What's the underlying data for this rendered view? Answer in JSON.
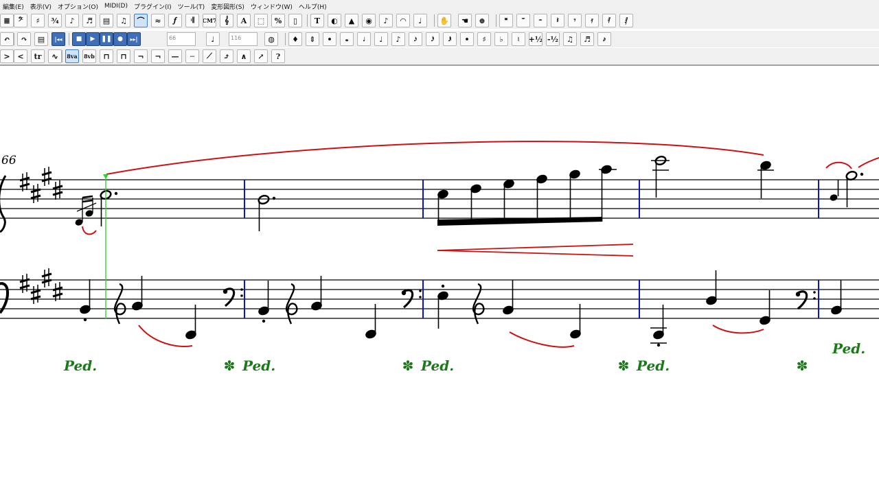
{
  "menu": [
    "編集(E)",
    "表示(V)",
    "オプション(O)",
    "MIDI(D)",
    "プラグイン(I)",
    "ツール(T)",
    "変形図形(S)",
    "ウィンドウ(W)",
    "ヘルプ(H)"
  ],
  "toolbar1": [
    {
      "name": "staff-tool-button",
      "glyph": "≣"
    },
    {
      "name": "clef-tool-button",
      "glyph": "𝄢"
    },
    {
      "name": "key-signature-tool-button",
      "glyph": "♯"
    },
    {
      "name": "time-signature-tool-button",
      "glyph": "¾"
    },
    {
      "name": "note-tool-button",
      "glyph": "♪"
    },
    {
      "name": "simple-entry-button",
      "glyph": "♬"
    },
    {
      "name": "measure-tool-button",
      "glyph": "▤"
    },
    {
      "name": "tuplet-tool-button",
      "glyph": "♫"
    },
    {
      "name": "smart-shape-tool-button",
      "glyph": "⌒"
    },
    {
      "name": "articulation-tool-button",
      "glyph": "≈"
    },
    {
      "name": "expression-tool-button",
      "glyph": "𝆑"
    },
    {
      "name": "repeat-tool-button",
      "glyph": "𝄇"
    },
    {
      "name": "chord-tool-button",
      "glyph": "CM7"
    },
    {
      "name": "lyrics-tool-button",
      "glyph": "𝄞"
    },
    {
      "name": "text-tool-button",
      "glyph": "A"
    },
    {
      "name": "selection-tool-button",
      "glyph": "⬚"
    },
    {
      "name": "resize-tool-button",
      "glyph": "%"
    },
    {
      "name": "page-layout-tool-button",
      "glyph": "▯"
    },
    {
      "name": "special-tools-button",
      "glyph": "T"
    },
    {
      "name": "mirror-tool-button",
      "glyph": "◐"
    },
    {
      "name": "graphics-tool-button",
      "glyph": "▲"
    },
    {
      "name": "speedy-entry-button",
      "glyph": "◉"
    },
    {
      "name": "playback-controls-button",
      "glyph": "♪"
    },
    {
      "name": "ossia-tool-button",
      "glyph": "◠"
    },
    {
      "name": "tempo-tool-button",
      "glyph": "♩"
    },
    {
      "name": "hand-grabber-button",
      "glyph": "✋"
    },
    {
      "name": "scroll-view-button",
      "glyph": "☚"
    },
    {
      "name": "zoom-tool-button",
      "glyph": "⊕"
    },
    {
      "name": "double-whole-rest-button",
      "glyph": "𝄺"
    },
    {
      "name": "whole-rest-button",
      "glyph": "𝄻"
    },
    {
      "name": "half-rest-button",
      "glyph": "𝄼"
    },
    {
      "name": "quarter-rest-button",
      "glyph": "𝄽"
    },
    {
      "name": "eighth-rest-button",
      "glyph": "𝄾"
    },
    {
      "name": "sixteenth-rest-button",
      "glyph": "𝄿"
    },
    {
      "name": "thirty-second-rest-button",
      "glyph": "𝅀"
    },
    {
      "name": "sixty-fourth-rest-button",
      "glyph": "𝅁"
    }
  ],
  "toolbar2": [
    {
      "name": "undo-button",
      "glyph": "↶"
    },
    {
      "name": "redo-button",
      "glyph": "↷"
    },
    {
      "name": "page-button",
      "glyph": "▤"
    },
    {
      "name": "rewind-button",
      "glyph": "|◂◂"
    },
    {
      "name": "stop-button",
      "glyph": "■"
    },
    {
      "name": "play-button",
      "glyph": "▶"
    },
    {
      "name": "pause-button",
      "glyph": "❚❚"
    },
    {
      "name": "record-button",
      "glyph": "●"
    },
    {
      "name": "fast-forward-button",
      "glyph": "▸▸|"
    },
    {
      "name": "tempo-note-button",
      "glyph": "♩"
    },
    {
      "name": "midi-device-button",
      "glyph": "◍"
    },
    {
      "name": "hyper-scribe-button",
      "glyph": "♦"
    },
    {
      "name": "voice-button",
      "glyph": "⇕"
    },
    {
      "name": "dot-tool-button",
      "glyph": "•"
    },
    {
      "name": "whole-note-button",
      "glyph": "𝅝"
    },
    {
      "name": "half-note-button",
      "glyph": "𝅗𝅥"
    },
    {
      "name": "quarter-note-button",
      "glyph": "♩"
    },
    {
      "name": "eighth-note-button",
      "glyph": "♪"
    },
    {
      "name": "sixteenth-note-button",
      "glyph": "𝅘𝅥𝅯"
    },
    {
      "name": "thirty-second-note-button",
      "glyph": "𝅘𝅥𝅰"
    },
    {
      "name": "sixty-fourth-note-button",
      "glyph": "𝅘𝅥𝅱"
    },
    {
      "name": "augmentation-dot-button",
      "glyph": "•"
    },
    {
      "name": "sharp-button",
      "glyph": "♯"
    },
    {
      "name": "flat-button",
      "glyph": "♭"
    },
    {
      "name": "natural-button",
      "glyph": "♮"
    },
    {
      "name": "half-step-up-button",
      "glyph": "+½"
    },
    {
      "name": "half-step-down-button",
      "glyph": "-½"
    },
    {
      "name": "tie-button",
      "glyph": "♫"
    },
    {
      "name": "tuplet-button",
      "glyph": "♬"
    },
    {
      "name": "grace-note-button",
      "glyph": "𝆔"
    }
  ],
  "toolbar3": [
    {
      "name": "crescendo-button",
      "glyph": ">"
    },
    {
      "name": "decrescendo-button",
      "glyph": "<"
    },
    {
      "name": "trill-button",
      "glyph": "tr"
    },
    {
      "name": "trill-extension-button",
      "glyph": "∿"
    },
    {
      "name": "octave-up-button",
      "glyph": "8va"
    },
    {
      "name": "octave-down-button",
      "glyph": "8vb"
    },
    {
      "name": "bracket-button",
      "glyph": "⊓"
    },
    {
      "name": "dashed-bracket-button",
      "glyph": "⊓"
    },
    {
      "name": "end-bracket-button",
      "glyph": "¬"
    },
    {
      "name": "dashed-end-bracket-button",
      "glyph": "¬"
    },
    {
      "name": "line-button",
      "glyph": "—"
    },
    {
      "name": "dashed-line-button",
      "glyph": "┄"
    },
    {
      "name": "glissando-button",
      "glyph": "⟋"
    },
    {
      "name": "bend-hat-button",
      "glyph": "⤴"
    },
    {
      "name": "hat-button",
      "glyph": "∧"
    },
    {
      "name": "guitar-bend-button",
      "glyph": "↗"
    },
    {
      "name": "help-button",
      "glyph": "?"
    }
  ],
  "tempo_field": "66",
  "bpm_field": "116",
  "score": {
    "measure_number": "66",
    "pedal_mark": "Ped.",
    "pedal_release": "✽"
  },
  "colors": {
    "toolbar_bg": "#f0f0f0",
    "barline": "#0a14c8",
    "slur": "#d01010",
    "pedal": "#1a7a1a",
    "cursor": "#2bd02b",
    "active_button": "#cfe4fb"
  }
}
